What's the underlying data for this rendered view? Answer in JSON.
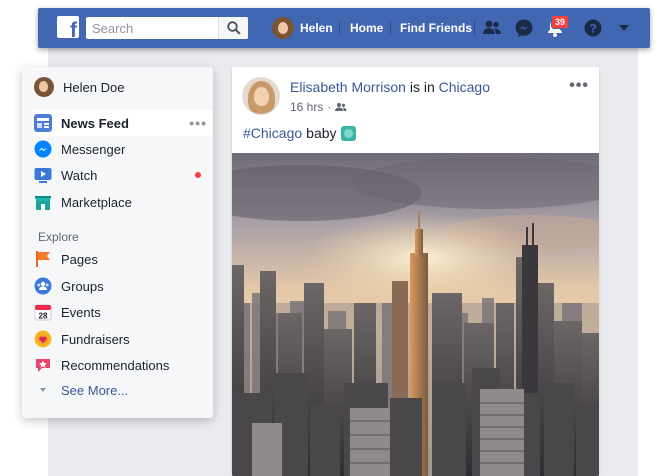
{
  "topbar": {
    "logo_letter": "f",
    "search_placeholder": "Search",
    "profile_name": "Helen",
    "nav_home": "Home",
    "nav_find_friends": "Find Friends",
    "notification_count": "39",
    "icons": [
      "friend-requests-icon",
      "messenger-icon",
      "notifications-icon",
      "help-icon",
      "account-menu-caret-icon"
    ]
  },
  "sidebar": {
    "profile_name": "Helen Doe",
    "items": [
      {
        "label": "News Feed",
        "icon": "news-feed-icon",
        "active": true
      },
      {
        "label": "Messenger",
        "icon": "messenger-icon"
      },
      {
        "label": "Watch",
        "icon": "watch-icon",
        "has_dot": true
      },
      {
        "label": "Marketplace",
        "icon": "marketplace-icon"
      }
    ],
    "explore_heading": "Explore",
    "explore_items": [
      {
        "label": "Pages",
        "icon": "pages-flag-icon"
      },
      {
        "label": "Groups",
        "icon": "groups-icon"
      },
      {
        "label": "Events",
        "icon": "events-calendar-icon",
        "calendar_day": "28"
      },
      {
        "label": "Fundraisers",
        "icon": "fundraisers-icon"
      },
      {
        "label": "Recommendations",
        "icon": "recommendations-icon"
      }
    ],
    "see_more": "See More..."
  },
  "post": {
    "author": "Elisabeth Morrison",
    "is_in": "is in",
    "location": "Chicago",
    "time": "16 hrs",
    "audience_icon": "friends-audience-icon",
    "hashtag": "#Chicago",
    "text": "baby",
    "photo_description_icon": "chicago-skyline-photo"
  },
  "colors": {
    "brand_blue": "#4267b2",
    "link_blue": "#385898",
    "badge_red": "#fa3e3e",
    "page_bg": "#e9ebee"
  }
}
